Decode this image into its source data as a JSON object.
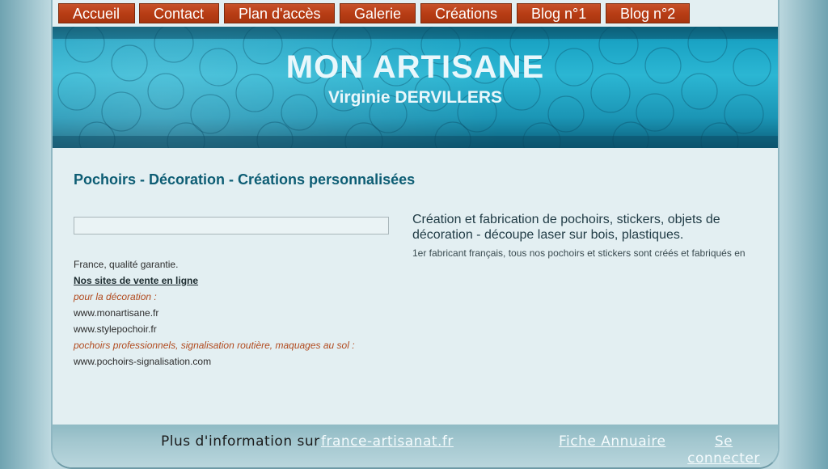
{
  "nav": {
    "items": [
      {
        "label": "Accueil"
      },
      {
        "label": "Contact"
      },
      {
        "label": "Plan d'accès"
      },
      {
        "label": "Galerie"
      },
      {
        "label": "Créations"
      },
      {
        "label": "Blog n°1"
      },
      {
        "label": "Blog n°2"
      }
    ]
  },
  "banner": {
    "title": "MON ARTISANE",
    "subtitle": "Virginie DERVILLERS"
  },
  "main": {
    "heading": "Pochoirs - Décoration - Créations personnalisées",
    "left_lines": [
      {
        "text": "France, qualité garantie.",
        "style": "normal"
      },
      {
        "text": "Nos sites de vente en ligne ",
        "style": "bold-u"
      },
      {
        "text": "pour la décoration :",
        "style": "italic-red"
      },
      {
        "text": "www.monartisane.fr",
        "style": "normal"
      },
      {
        "text": "www.stylepochoir.fr",
        "style": "normal"
      },
      {
        "text": "pochoirs professionnels, signalisation routière, maquages au sol :",
        "style": "italic-red"
      },
      {
        "text": "www.pochoirs-signalisation.com",
        "style": "normal"
      }
    ],
    "description": "Création et fabrication  de pochoirs, stickers, objets de décoration - découpe laser sur bois, plastiques.",
    "description_sub": "1er fabricant français, tous nos pochoirs et stickers sont créés et fabriqués en"
  },
  "footer": {
    "info_text": "Plus d'information sur",
    "info_link": "france-artisanat.fr",
    "annuaire_link": "Fiche Annuaire",
    "login_link": "Se connecter"
  },
  "colors": {
    "nav_button": "#b83d15",
    "heading": "#0d5d74",
    "banner": "#1aa3c4",
    "italic_accent": "#b14a1e"
  }
}
